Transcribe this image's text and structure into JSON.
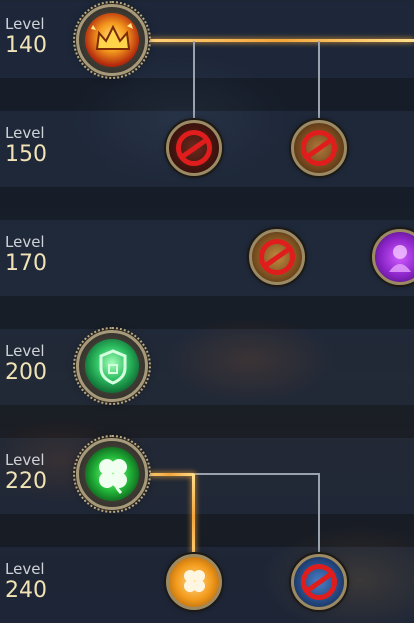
{
  "tree": {
    "rows": [
      {
        "word": "Level",
        "number": "140"
      },
      {
        "word": "Level",
        "number": "150"
      },
      {
        "word": "Level",
        "number": "170"
      },
      {
        "word": "Level",
        "number": "200"
      },
      {
        "word": "Level",
        "number": "220"
      },
      {
        "word": "Level",
        "number": "240"
      }
    ],
    "nodes": [
      {
        "level": "140",
        "icon": "fire-crown-icon",
        "state": "unlocked"
      },
      {
        "level": "150",
        "icon": "locked-skill-icon",
        "state": "locked"
      },
      {
        "level": "150",
        "icon": "locked-skill-icon",
        "state": "locked"
      },
      {
        "level": "170",
        "icon": "locked-skill-icon",
        "state": "locked"
      },
      {
        "level": "170",
        "icon": "purple-spirit-icon",
        "state": "available"
      },
      {
        "level": "200",
        "icon": "green-shield-icon",
        "state": "unlocked"
      },
      {
        "level": "220",
        "icon": "green-clover-icon",
        "state": "unlocked"
      },
      {
        "level": "240",
        "icon": "gold-clover-icon",
        "state": "available"
      },
      {
        "level": "240",
        "icon": "locked-skill-icon",
        "state": "locked"
      }
    ]
  },
  "colors": {
    "gold_path": "#f2a53a",
    "grey_path": "#9aa3ad",
    "lock_red": "#e01d1d",
    "level_number": "#f1e3b6"
  }
}
